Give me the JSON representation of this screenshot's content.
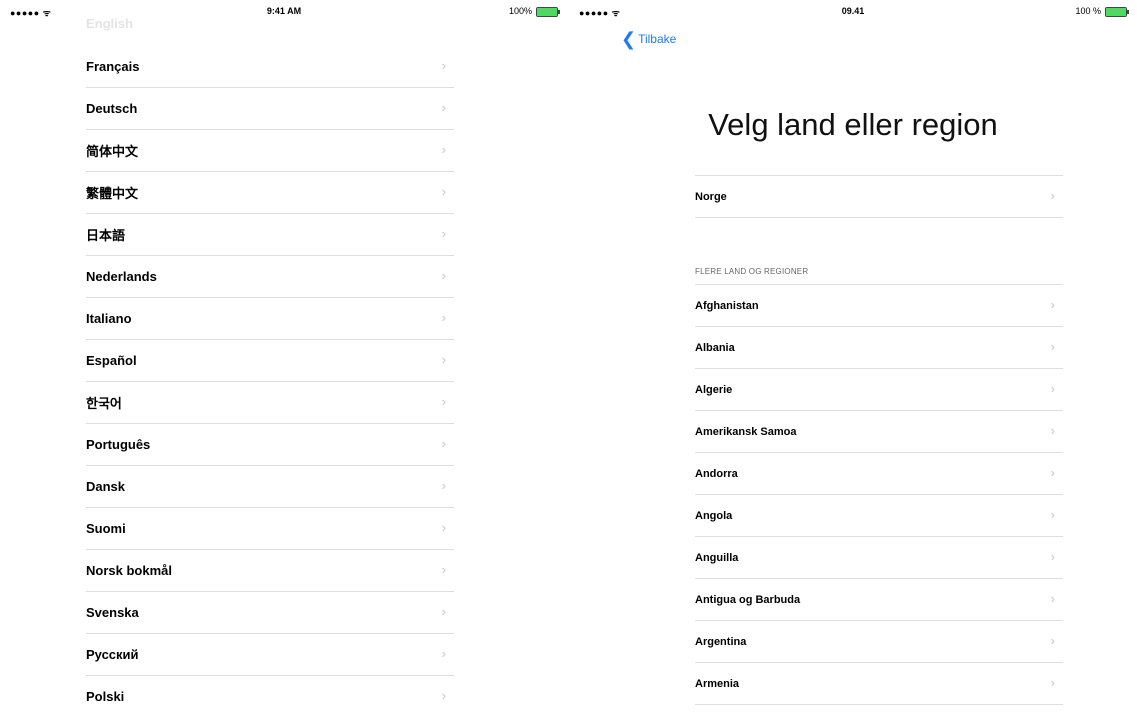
{
  "left_screen": {
    "status": {
      "signal": "●●●●● ᯤ",
      "time": "9:41 AM",
      "battery": "100%",
      "battery_level": 1.0
    },
    "previous_item": "English",
    "languages": [
      "Français",
      "Deutsch",
      "简体中文",
      "繁體中文",
      "日本語",
      "Nederlands",
      "Italiano",
      "Español",
      "한국어",
      "Português",
      "Dansk",
      "Suomi",
      "Norsk bokmål",
      "Svenska",
      "Русский",
      "Polski"
    ]
  },
  "right_screen": {
    "status": {
      "signal": "●●●●● ᯤ",
      "time": "09.41",
      "battery": "100 %",
      "battery_level": 1.0
    },
    "back_label": "Tilbake",
    "title": "Velg land eller region",
    "current_country": "Norge",
    "section_header": "FLERE LAND OG REGIONER",
    "countries": [
      "Afghanistan",
      "Albania",
      "Algerie",
      "Amerikansk Samoa",
      "Andorra",
      "Angola",
      "Anguilla",
      "Antigua og Barbuda",
      "Argentina",
      "Armenia"
    ]
  },
  "icons": {
    "chevron": "›",
    "back_arrow": "❮"
  },
  "colors": {
    "accent": "#1d7cf2",
    "battery": "#4cd964",
    "separator": "#dedede",
    "chevron": "#c7c7cc"
  }
}
